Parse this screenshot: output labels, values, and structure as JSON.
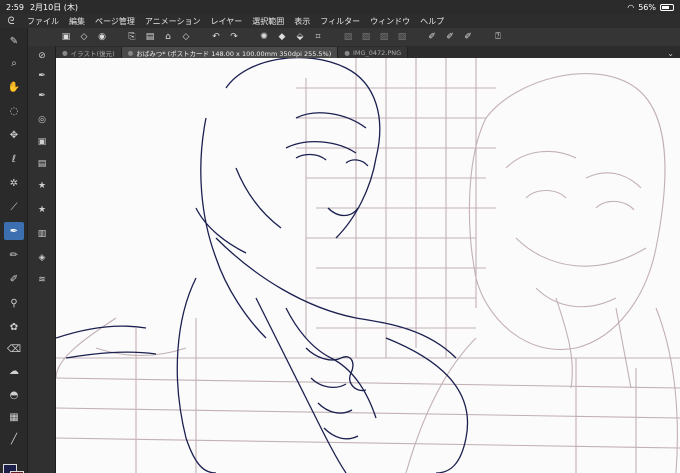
{
  "status_bar": {
    "time": "2:59",
    "date": "2月10日 (木)",
    "battery": "56%",
    "battery_level": 0.56
  },
  "menu": {
    "items": [
      "ファイル",
      "編集",
      "ページ管理",
      "アニメーション",
      "レイヤー",
      "選択範囲",
      "表示",
      "フィルター",
      "ウィンドウ",
      "ヘルプ"
    ]
  },
  "tabs": [
    {
      "label": "イラスト(復元)"
    },
    {
      "label": "おばみつ* (ポストカード 148.00 x 100.00mm 350dpi 255.5%)"
    },
    {
      "label": "IMG_0472.PNG"
    }
  ],
  "colors": {
    "main_color": "#1b1f4a",
    "sub_color": "#5a1d1d",
    "accent": "#3b6fb0"
  }
}
